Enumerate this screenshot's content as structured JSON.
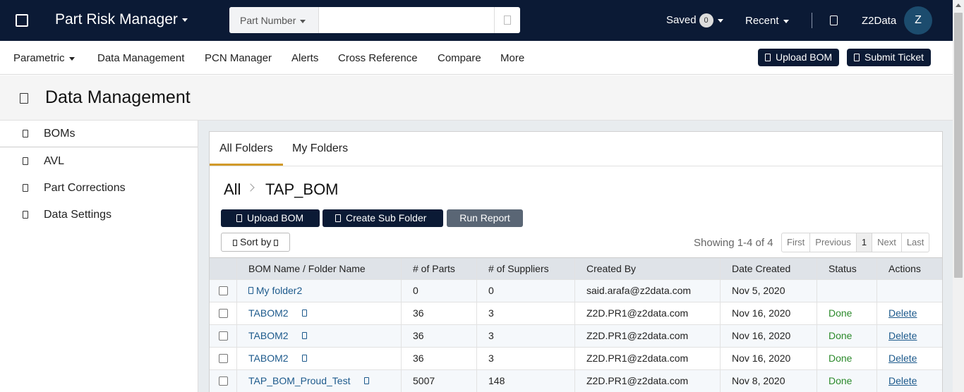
{
  "header": {
    "app_title": "Part Risk Manager",
    "search_type": "Part Number",
    "search_placeholder": "",
    "saved_label": "Saved",
    "saved_count": "0",
    "recent_label": "Recent",
    "user_name": "Z2Data",
    "avatar_initial": "Z"
  },
  "nav": {
    "items": [
      "Parametric",
      "Data Management",
      "PCN Manager",
      "Alerts",
      "Cross Reference",
      "Compare",
      "More"
    ],
    "upload_bom": "Upload BOM",
    "submit_ticket": "Submit Ticket"
  },
  "page": {
    "title": "Data Management"
  },
  "sidebar": {
    "items": [
      {
        "label": "BOMs",
        "active": true
      },
      {
        "label": "AVL"
      },
      {
        "label": "Part Corrections"
      },
      {
        "label": "Data Settings"
      }
    ]
  },
  "tabs": [
    "All Folders",
    "My Folders"
  ],
  "breadcrumb": {
    "root": "All",
    "current": "TAP_BOM"
  },
  "actions": {
    "upload_bom": "Upload BOM",
    "create_sub_folder": "Create Sub Folder",
    "run_report": "Run Report"
  },
  "sort_label": "Sort by",
  "pagination": {
    "showing": "Showing 1-4 of 4",
    "first": "First",
    "previous": "Previous",
    "page": "1",
    "next": "Next",
    "last": "Last"
  },
  "table": {
    "columns": [
      "BOM Name / Folder Name",
      "# of Parts",
      "# of Suppliers",
      "Created By",
      "Date Created",
      "Status",
      "Actions"
    ],
    "rows": [
      {
        "name": "My folder2",
        "parts": "0",
        "suppliers": "0",
        "created_by": "said.arafa@z2data.com",
        "date": "Nov 5, 2020",
        "status": "",
        "action": ""
      },
      {
        "name": "TABOM2",
        "parts": "36",
        "suppliers": "3",
        "created_by": "Z2D.PR1@z2data.com",
        "date": "Nov 16, 2020",
        "status": "Done",
        "action": "Delete"
      },
      {
        "name": "TABOM2",
        "parts": "36",
        "suppliers": "3",
        "created_by": "Z2D.PR1@z2data.com",
        "date": "Nov 16, 2020",
        "status": "Done",
        "action": "Delete"
      },
      {
        "name": "TABOM2",
        "parts": "36",
        "suppliers": "3",
        "created_by": "Z2D.PR1@z2data.com",
        "date": "Nov 16, 2020",
        "status": "Done",
        "action": "Delete"
      },
      {
        "name": "TAP_BOM_Proud_Test",
        "parts": "5007",
        "suppliers": "148",
        "created_by": "Z2D.PR1@z2data.com",
        "date": "Nov 8, 2020",
        "status": "Done",
        "action": "Delete"
      }
    ]
  }
}
